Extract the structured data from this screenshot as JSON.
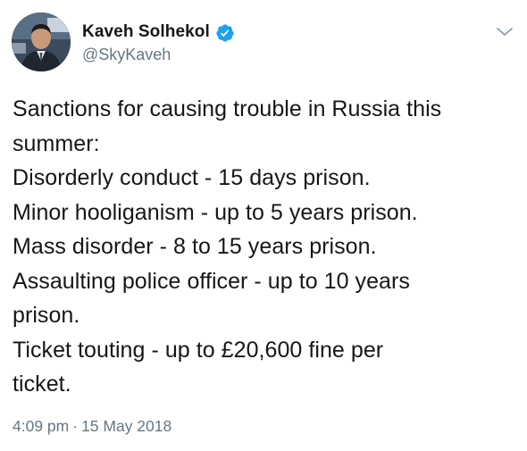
{
  "tweet": {
    "author": {
      "display_name": "Kaveh Solhekol",
      "handle": "@SkyKaveh",
      "verified_icon": "verified-badge-icon",
      "verified_color": "#1da1f2"
    },
    "menu_icon": "chevron-down-icon",
    "text_lines": [
      "Sanctions for causing trouble in Russia this",
      "summer:",
      "Disorderly conduct - 15 days prison.",
      "Minor hooliganism - up to 5 years prison.",
      "Mass disorder - 8 to 15 years prison.",
      "Assaulting police officer - up to 10 years",
      "prison.",
      "Ticket touting - up to £20,600 fine per",
      "ticket."
    ],
    "time": "4:09 pm",
    "separator": "·",
    "date": "15 May 2018"
  },
  "colors": {
    "text": "#14171a",
    "secondary": "#657786",
    "accent": "#1da1f2"
  }
}
